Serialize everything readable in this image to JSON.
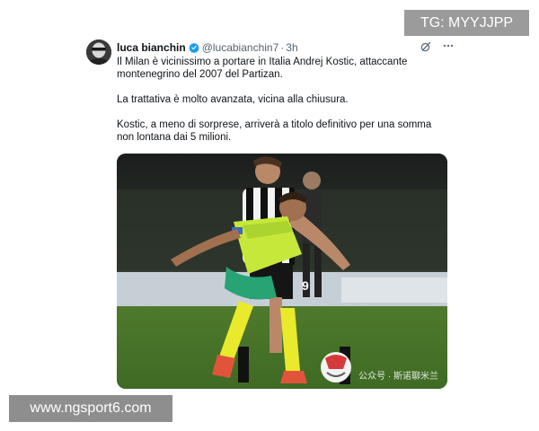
{
  "overlay": {
    "tg_label": "TG: MYYJJPP",
    "site_label": "www.ngsport6.com"
  },
  "tweet": {
    "author_name": "luca bianchin",
    "handle": "@lucabianchin7",
    "separator": "·",
    "time": "3h",
    "paragraphs": [
      "Il Milan è vicinissimo a portare in Italia Andrej Kostic, attaccante montenegrino del 2007 del Partizan.",
      "La trattativa è molto avanzata, vicina alla chiusura.",
      "Kostic, a meno di sorprese, arriverà a titolo definitivo per una somma non lontana dai 5 milioni."
    ],
    "media": {
      "watermark": "公众号 · 斯诺聊米兰",
      "jersey_number": "9"
    }
  },
  "colors": {
    "verified": "#1d9bf0",
    "secondary_text": "#536471",
    "milan_kit": "#c6e83a",
    "partizan_kit": "#111111"
  },
  "icons": {
    "verified": "verified-badge-icon",
    "grok": "grok-icon",
    "more": "more-icon"
  }
}
